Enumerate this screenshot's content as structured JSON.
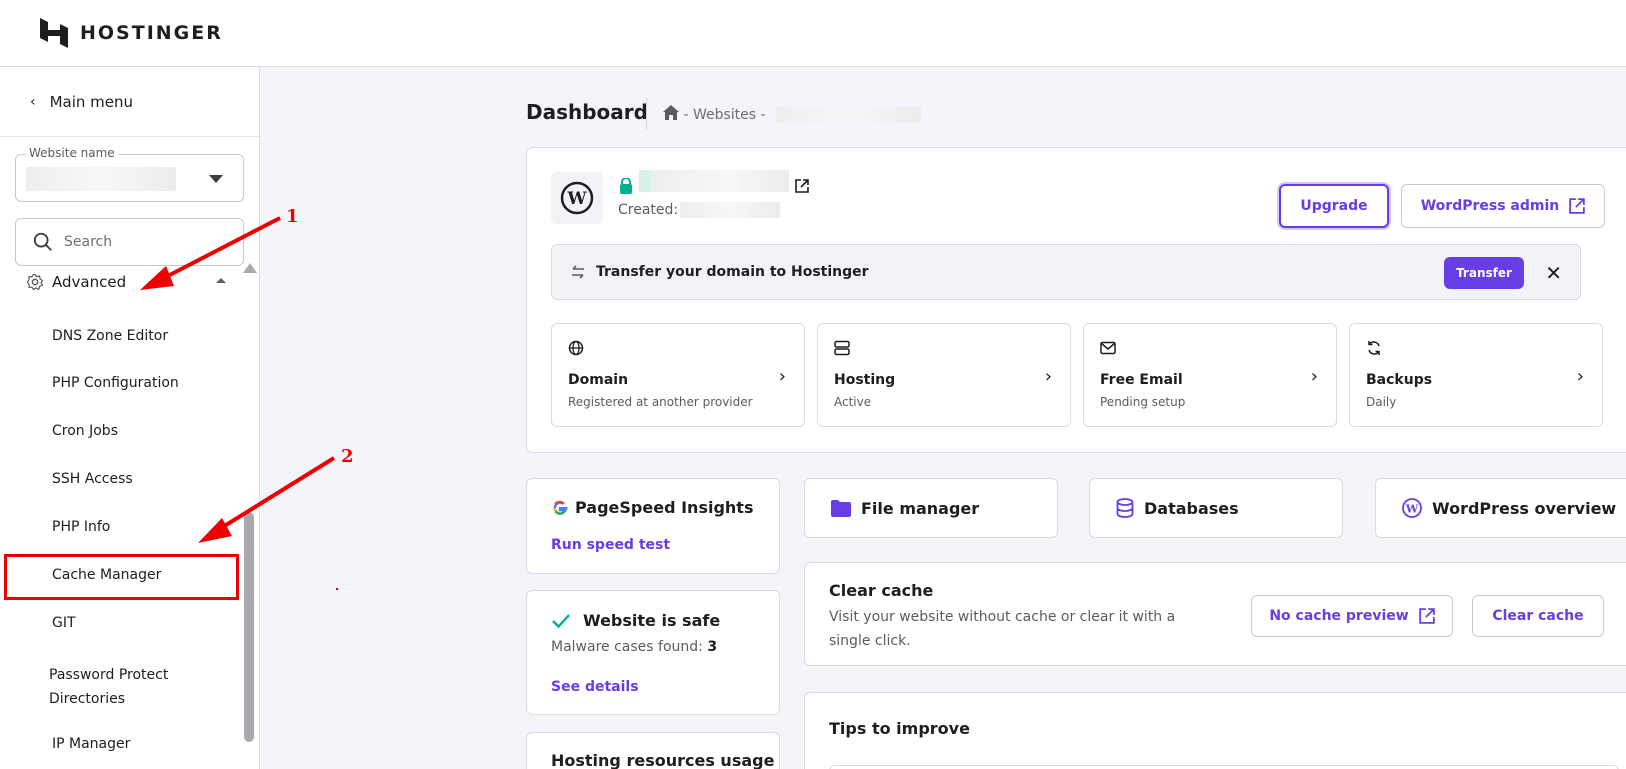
{
  "header": {
    "logo_text": "HOSTINGER"
  },
  "sidebar": {
    "main_menu_label": "Main menu",
    "website_select": {
      "label": "Website name"
    },
    "search": {
      "placeholder": "Search"
    },
    "section": {
      "label": "Advanced"
    },
    "items": [
      {
        "label": "DNS Zone Editor"
      },
      {
        "label": "PHP Configuration"
      },
      {
        "label": "Cron Jobs"
      },
      {
        "label": "SSH Access"
      },
      {
        "label": "PHP Info"
      },
      {
        "label": "Cache Manager"
      },
      {
        "label": "GIT"
      },
      {
        "label": "Password Protect Directories"
      },
      {
        "label": "IP Manager"
      }
    ]
  },
  "annotations": {
    "label_1": "1",
    "label_2": "2",
    "color": "#e00000"
  },
  "main": {
    "title": "Dashboard",
    "breadcrumb": {
      "sep1": " - Websites - "
    },
    "site_card": {
      "created_label": "Created:",
      "upgrade_label": "Upgrade",
      "wp_admin_label": "WordPress admin"
    },
    "transfer": {
      "text": "Transfer your domain to Hostinger",
      "button": "Transfer"
    },
    "tiles": [
      {
        "icon": "globe-icon",
        "title": "Domain",
        "subtitle": "Registered at another provider"
      },
      {
        "icon": "server-icon",
        "title": "Hosting",
        "subtitle": "Active"
      },
      {
        "icon": "mail-icon",
        "title": "Free Email",
        "subtitle": "Pending setup"
      },
      {
        "icon": "sync-icon",
        "title": "Backups",
        "subtitle": "Daily"
      }
    ],
    "pagespeed": {
      "title": "PageSpeed Insights",
      "link": "Run speed test"
    },
    "file_manager": {
      "title": "File manager"
    },
    "databases": {
      "title": "Databases"
    },
    "wp_overview": {
      "title": "WordPress overview"
    },
    "security": {
      "title": "Website is safe",
      "malware_label": "Malware cases found:",
      "malware_count": "3",
      "link": "See details"
    },
    "clear_cache": {
      "title": "Clear cache",
      "description": "Visit your website without cache or clear it with a single click.",
      "preview_button": "No cache preview",
      "clear_button": "Clear cache"
    },
    "resources": {
      "title": "Hosting resources usage"
    },
    "tips": {
      "title": "Tips to improve"
    }
  },
  "colors": {
    "accent": "#673de6",
    "success": "#00b090",
    "danger": "#e00000"
  }
}
